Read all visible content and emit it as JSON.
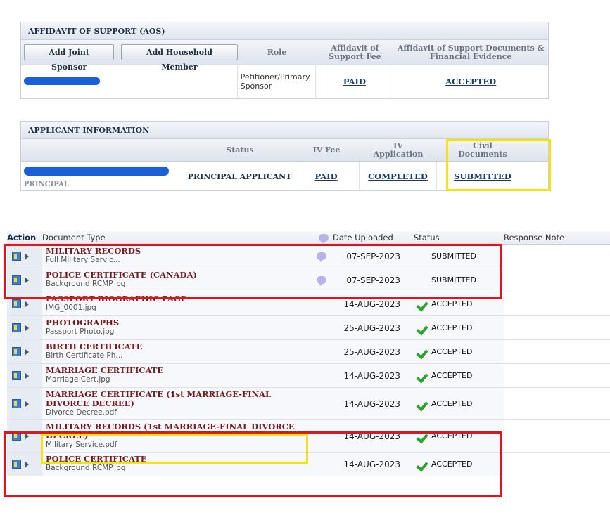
{
  "aos": {
    "title": "AFFIDAVIT OF SUPPORT (AOS)",
    "btn_joint": "Add Joint Sponsor",
    "btn_household": "Add Household Member",
    "col_role": "Role",
    "col_fee": "Affidavit of Support Fee",
    "col_docs": "Affidavit of Support Documents & Financial Evidence",
    "row": {
      "role": "Petitioner/Primary Sponsor",
      "fee": "PAID",
      "docs": "ACCEPTED"
    }
  },
  "applicant": {
    "title": "APPLICANT INFORMATION",
    "col_status": "Status",
    "col_fee": "IV Fee",
    "col_app": "IV Application",
    "col_civil": "Civil Documents",
    "row": {
      "sub": "PRINCIPAL",
      "status": "PRINCIPAL APPLICANT",
      "fee": "PAID",
      "app": "COMPLETED",
      "civil": "SUBMITTED"
    }
  },
  "docs": {
    "headers": {
      "action": "Action",
      "type": "Document Type",
      "date": "Date Uploaded",
      "status": "Status",
      "note": "Response Note"
    },
    "rows": [
      {
        "title": "MILITARY RECORDS",
        "file": "Full Military Servic...",
        "date": "07-SEP-2023",
        "status": "SUBMITTED"
      },
      {
        "title": "POLICE CERTIFICATE (CANADA)",
        "file": "Background RCMP.jpg",
        "date": "07-SEP-2023",
        "status": "SUBMITTED"
      },
      {
        "title": "PASSPORT BIOGRAPHIC PAGE",
        "file": "IMG_0001.jpg",
        "date": "14-AUG-2023",
        "status": "ACCEPTED"
      },
      {
        "title": "PHOTOGRAPHS",
        "file": "Passport Photo.jpg",
        "date": "25-AUG-2023",
        "status": "ACCEPTED"
      },
      {
        "title": "BIRTH CERTIFICATE",
        "file": "Birth Certificate Ph...",
        "date": "25-AUG-2023",
        "status": "ACCEPTED"
      },
      {
        "title": "MARRIAGE CERTIFICATE",
        "file": "Marriage Cert.jpg",
        "date": "14-AUG-2023",
        "status": "ACCEPTED"
      },
      {
        "title": "MARRIAGE CERTIFICATE (1st MARRIAGE-FINAL DIVORCE DECREE)",
        "file": "Divorce Decree.pdf",
        "date": "14-AUG-2023",
        "status": "ACCEPTED"
      },
      {
        "title": "MILITARY RECORDS (1st MARRIAGE-FINAL DIVORCE DECREE)",
        "file": "Military Service.pdf",
        "date": "14-AUG-2023",
        "status": "ACCEPTED"
      },
      {
        "title": "POLICE CERTIFICATE",
        "file": "Background RCMP.jpg",
        "date": "14-AUG-2023",
        "status": "ACCEPTED"
      }
    ]
  },
  "colors": {
    "link": "#163a6b",
    "doc_title": "#7a1a1a",
    "highlight_red": "#e3121d",
    "highlight_yellow": "#f3e214",
    "redaction": "#1a5fd6",
    "check": "#2fa12f"
  },
  "icons": {
    "row_action": "document-icon",
    "expand": "expand-arrow-icon",
    "note": "comment-bubble-icon",
    "accepted": "checkmark-icon"
  }
}
